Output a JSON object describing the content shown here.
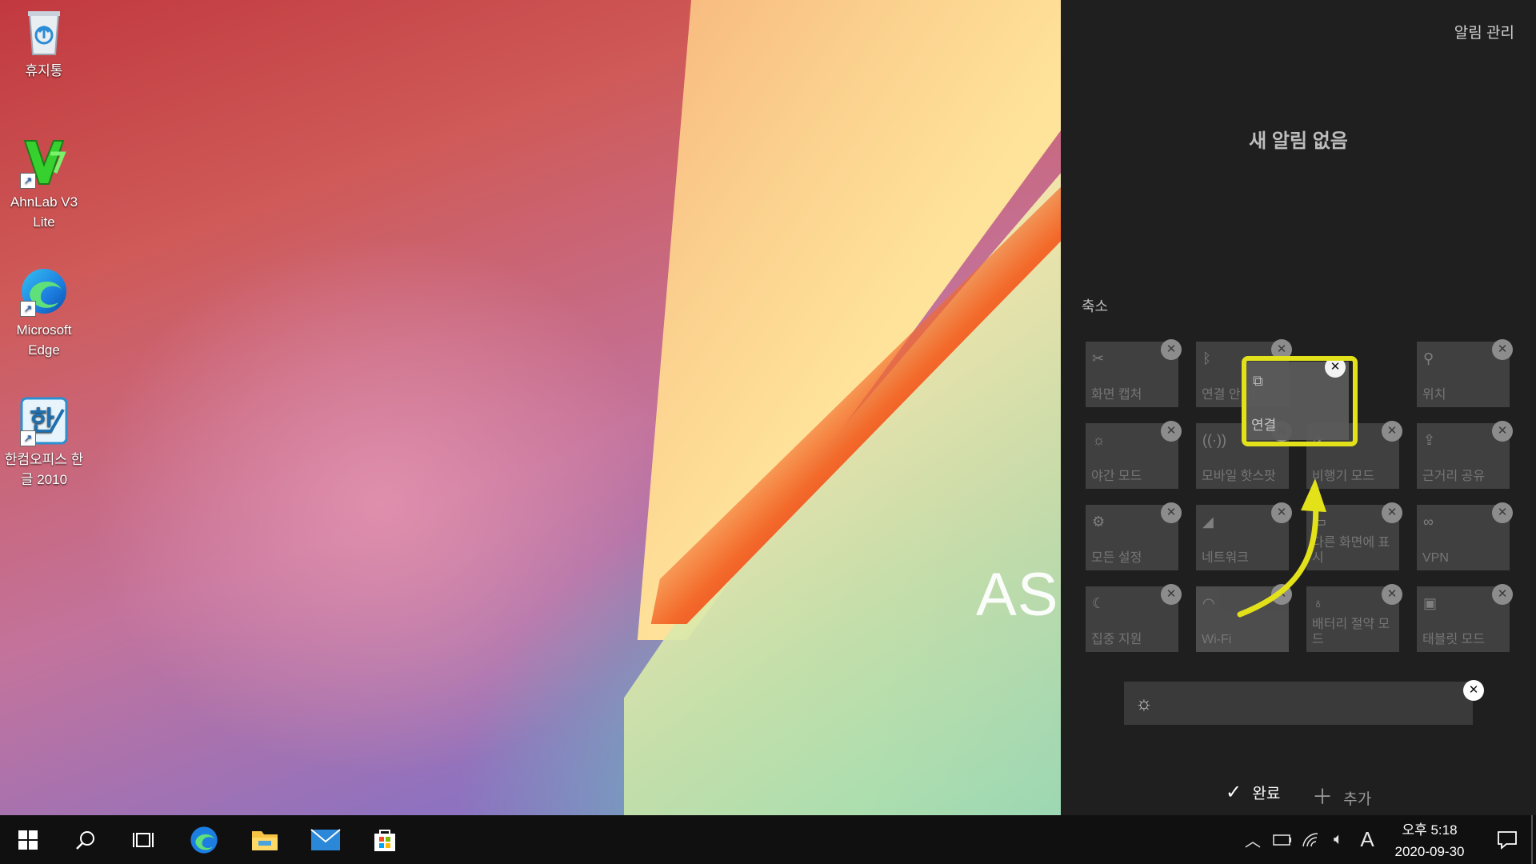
{
  "desktop": {
    "wallpaper_brand": "ASU",
    "icons": [
      {
        "label": "휴지통",
        "icon": "recycle-bin-icon"
      },
      {
        "label": "AhnLab V3 Lite",
        "icon": "ahnlab-v3-icon"
      },
      {
        "label": "Microsoft Edge",
        "icon": "edge-icon"
      },
      {
        "label": "한컴오피스 한글 2010",
        "icon": "hangul-icon"
      }
    ]
  },
  "action_center": {
    "manage_label": "알림 관리",
    "empty_label": "새 알림 없음",
    "collapse_label": "축소",
    "tiles": [
      {
        "label": "화면 캡처",
        "icon": "screen-snip-icon"
      },
      {
        "label": "연결 안 됨",
        "icon": "bluetooth-icon"
      },
      {
        "label": "위치",
        "icon": "location-icon"
      },
      {
        "label": "야간 모드",
        "icon": "night-light-icon"
      },
      {
        "label": "모바일 핫스팟",
        "icon": "hotspot-icon"
      },
      {
        "label": "비행기 모드",
        "icon": "airplane-icon"
      },
      {
        "label": "근거리 공유",
        "icon": "nearby-share-icon"
      },
      {
        "label": "모든 설정",
        "icon": "settings-icon"
      },
      {
        "label": "네트워크",
        "icon": "network-icon"
      },
      {
        "label": "다른 화면에 표시",
        "icon": "project-icon"
      },
      {
        "label": "VPN",
        "icon": "vpn-icon"
      },
      {
        "label": "집중 지원",
        "icon": "focus-assist-icon"
      },
      {
        "label": "Wi-Fi",
        "icon": "wifi-icon"
      },
      {
        "label": "배터리 절약 모드",
        "icon": "battery-saver-icon"
      },
      {
        "label": "태블릿 모드",
        "icon": "tablet-mode-icon"
      }
    ],
    "dragged_tile": {
      "label": "연결",
      "icon": "connect-icon"
    },
    "done_label": "완료",
    "add_label": "추가",
    "highlight_color": "#e3e21a"
  },
  "taskbar": {
    "apps": [
      "start-icon",
      "search-icon",
      "task-view-icon",
      "edge-icon",
      "file-explorer-icon",
      "mail-icon",
      "store-icon"
    ],
    "ime_label": "A",
    "time": "오후 5:18",
    "date": "2020-09-30"
  }
}
